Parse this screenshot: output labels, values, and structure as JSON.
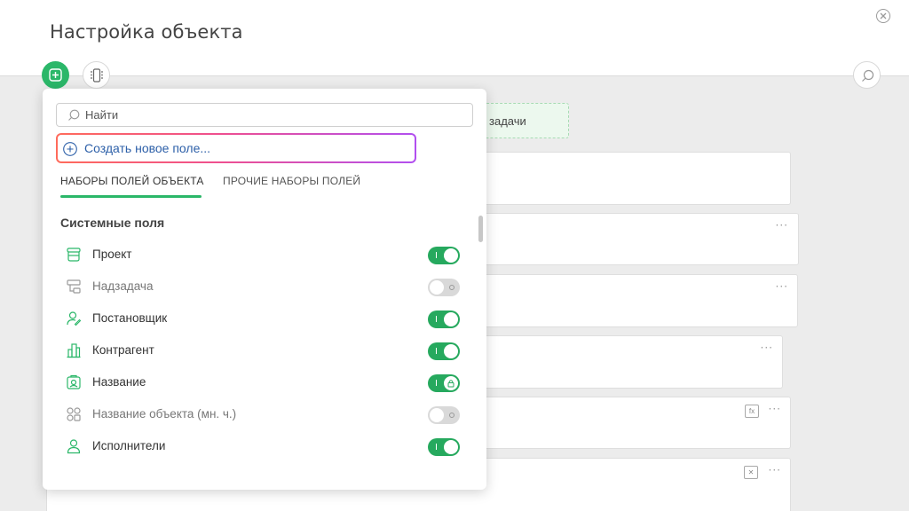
{
  "header": {
    "title": "Настройка объекта"
  },
  "drop_zone": {
    "label": "задачи"
  },
  "dropdown": {
    "search_placeholder": "Найти",
    "create_label": "Создать новое поле...",
    "tabs": [
      "НАБОРЫ ПОЛЕЙ ОБЪЕКТА",
      "ПРОЧИЕ НАБОРЫ ПОЛЕЙ"
    ],
    "active_tab": 0,
    "section_title": "Системные поля",
    "fields": [
      {
        "label": "Проект",
        "icon": "project-icon",
        "enabled": true
      },
      {
        "label": "Надзадача",
        "icon": "parent-task-icon",
        "enabled": false
      },
      {
        "label": "Постановщик",
        "icon": "author-icon",
        "enabled": true
      },
      {
        "label": "Контрагент",
        "icon": "contractor-icon",
        "enabled": true
      },
      {
        "label": "Название",
        "icon": "name-icon",
        "enabled": true,
        "locked": true
      },
      {
        "label": "Название объекта (мн. ч.)",
        "icon": "plural-name-icon",
        "enabled": false
      },
      {
        "label": "Исполнители",
        "icon": "assignees-icon",
        "enabled": true
      }
    ]
  },
  "colors": {
    "accent": "#2bb769",
    "toggle_on": "#26a95e",
    "link": "#2c5fa8"
  }
}
